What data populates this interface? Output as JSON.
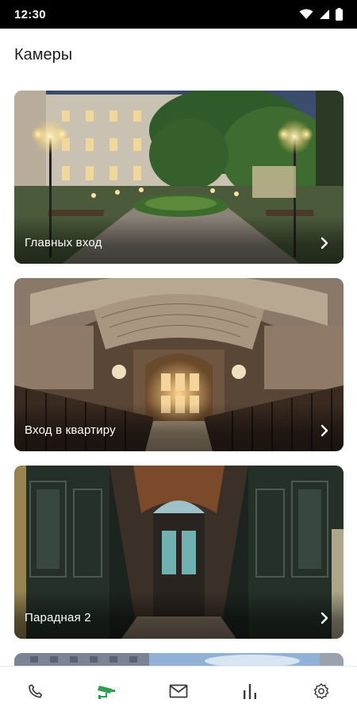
{
  "status_bar": {
    "time": "12:30"
  },
  "page": {
    "title": "Камеры"
  },
  "cameras": [
    {
      "label": "Главных вход"
    },
    {
      "label": "Вход в квартиру"
    },
    {
      "label": "Парадная 2"
    }
  ],
  "colors": {
    "accent": "#2e9e4f",
    "nav_icon": "#3a3a3a"
  },
  "bottom_nav": {
    "items": [
      {
        "icon": "phone-icon",
        "active": false
      },
      {
        "icon": "cctv-camera-icon",
        "active": true
      },
      {
        "icon": "mail-icon",
        "active": false
      },
      {
        "icon": "bar-chart-icon",
        "active": false
      },
      {
        "icon": "gear-icon",
        "active": false
      }
    ]
  }
}
